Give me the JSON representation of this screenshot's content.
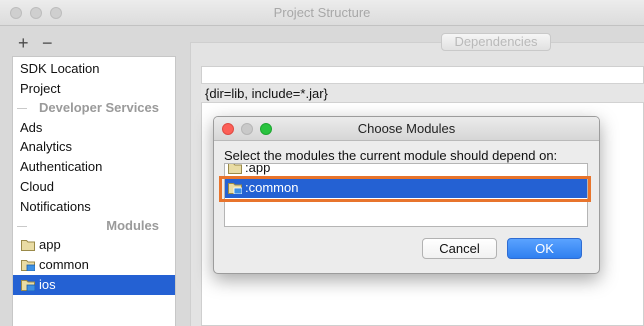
{
  "window": {
    "title": "Project Structure",
    "toolbar": {
      "add_label": "+",
      "remove_label": "−"
    }
  },
  "sidebar": {
    "items_top": [
      "SDK Location",
      "Project"
    ],
    "developer_services_label": "Developer Services",
    "services": [
      "Ads",
      "Analytics",
      "Authentication",
      "Cloud",
      "Notifications"
    ],
    "modules_label": "Modules",
    "modules": [
      {
        "label": "app",
        "icon": "folder-icon"
      },
      {
        "label": "common",
        "icon": "module-folder-icon"
      },
      {
        "label": "ios",
        "icon": "module-folder-icon",
        "selected": true
      }
    ]
  },
  "main": {
    "tab_label": "Dependencies",
    "dependency_row": "{dir=lib, include=*.jar}"
  },
  "dialog": {
    "title": "Choose Modules",
    "prompt": "Select the modules the current module should depend on:",
    "items": [
      {
        "label": ":app",
        "icon": "folder-icon"
      },
      {
        "label": ":common",
        "icon": "module-folder-icon",
        "selected": true
      }
    ],
    "cancel_label": "Cancel",
    "ok_label": "OK"
  },
  "colors": {
    "selection": "#2461d3",
    "highlight_border": "#e8742c",
    "traffic_close": "#fc5f57",
    "traffic_minimize": "#c9c9c9",
    "traffic_zoom": "#29c33f"
  }
}
